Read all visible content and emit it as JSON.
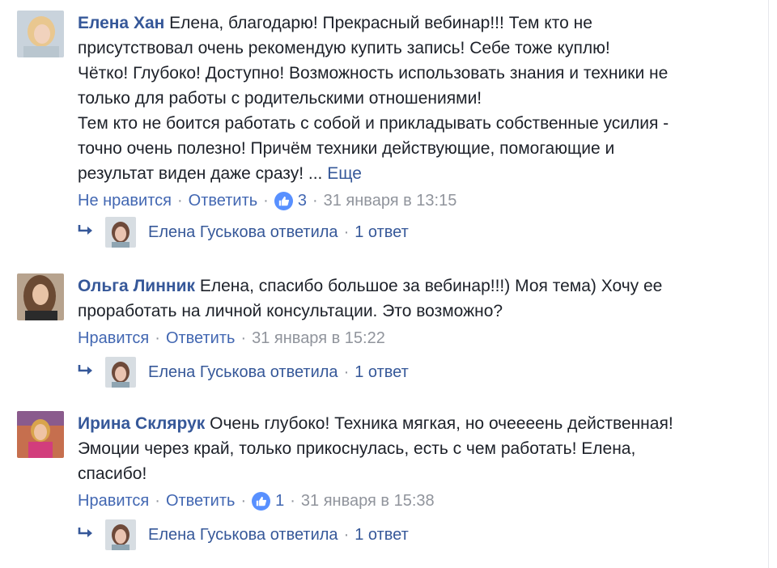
{
  "comments": [
    {
      "author": "Елена Хан",
      "lines": [
        "Елена, благодарю! Прекрасный вебинар!!! Тем кто не",
        "присутствовал очень рекомендую купить запись! Себе тоже куплю!",
        "Чётко! Глубоко! Доступно! Возможность использовать знания и техники не",
        "только для работы с родительскими отношениями!",
        "Тем кто не боится работать с собой и прикладывать собственные усилия -",
        "точно очень полезно! Причём техники действующие, помогающие и",
        "результат виден даже сразу! ..."
      ],
      "more": "Еще",
      "like_label": "Не нравится",
      "reply_label": "Ответить",
      "reactions": "3",
      "time": "31 января в 13:15",
      "reply_summary": {
        "name": "Елена Гуськова ответила",
        "count": "1 ответ"
      }
    },
    {
      "author": "Ольга Линник",
      "lines": [
        "Елена, спасибо большое за вебинар!!!) Моя тема) Хочу ее",
        "проработать на личной консультации. Это возможно?"
      ],
      "like_label": "Нравится",
      "reply_label": "Ответить",
      "time": "31 января в 15:22",
      "reply_summary": {
        "name": "Елена Гуськова ответила",
        "count": "1 ответ"
      }
    },
    {
      "author": "Ирина Склярук",
      "lines": [
        "Очень глубоко! Техника мягкая, но очеееень действенная!",
        "Эмоции через край, только прикоснулась, есть с чем работать! Елена,",
        "спасибо!"
      ],
      "like_label": "Нравится",
      "reply_label": "Ответить",
      "reactions": "1",
      "time": "31 января в 15:38",
      "reply_summary": {
        "name": "Елена Гуськова ответила",
        "count": "1 ответ"
      }
    }
  ],
  "separator": "·",
  "colors": {
    "link": "#365899",
    "action": "#4267b2",
    "meta": "#90949c",
    "like_badge": "#5890ff"
  },
  "icons": {
    "reply_arrow": "reply-arrow-icon",
    "like": "thumbs-up-icon"
  }
}
